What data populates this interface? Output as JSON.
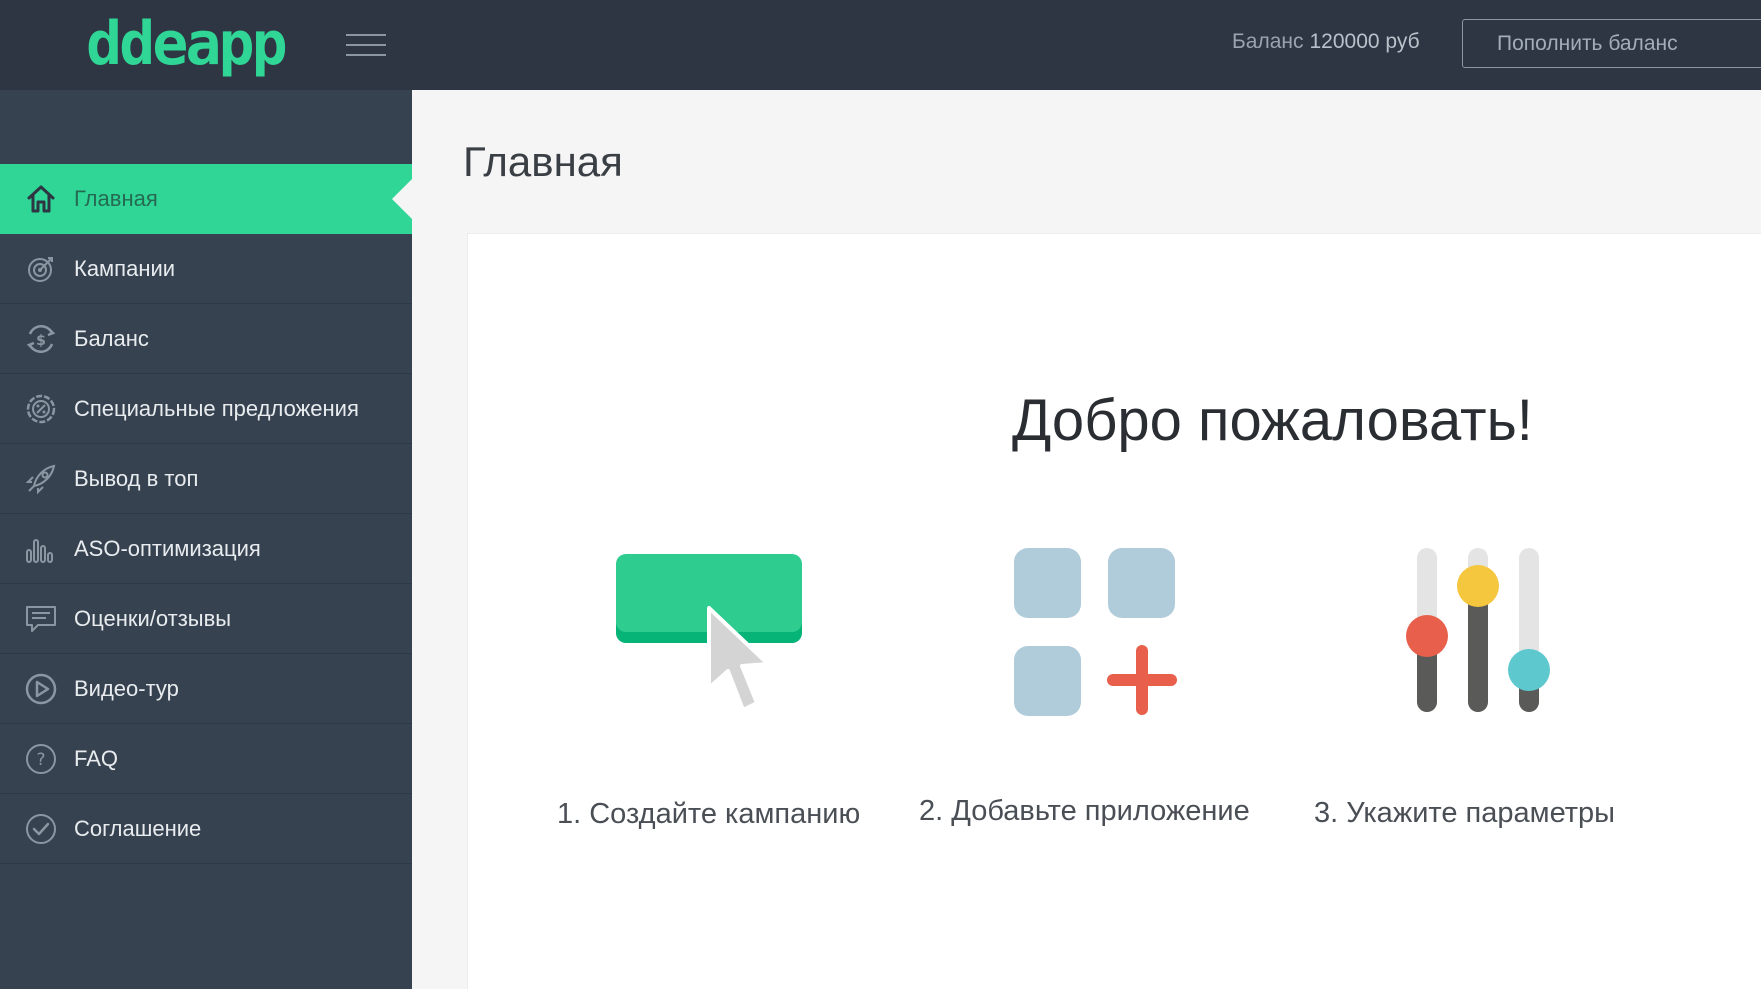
{
  "header": {
    "logo_text": "ddeapp",
    "balance_label": "Баланс",
    "balance_amount": "120000 руб",
    "topup_label": "Пополнить баланс",
    "hamburger_icon": "menu-icon"
  },
  "sidebar": {
    "items": [
      {
        "label": "Главная",
        "icon": "home-icon",
        "active": true
      },
      {
        "label": "Кампании",
        "icon": "target-icon"
      },
      {
        "label": "Баланс",
        "icon": "money-refresh-icon"
      },
      {
        "label": "Специальные предложения",
        "icon": "percent-badge-icon"
      },
      {
        "label": "Вывод в топ",
        "icon": "rocket-icon"
      },
      {
        "label": "ASO-оптимизация",
        "icon": "bar-chart-icon"
      },
      {
        "label": "Оценки/отзывы",
        "icon": "comment-icon"
      },
      {
        "label": "Видео-тур",
        "icon": "play-icon"
      },
      {
        "label": "FAQ",
        "icon": "question-icon"
      },
      {
        "label": "Соглашение",
        "icon": "check-circle-icon"
      }
    ]
  },
  "main": {
    "page_title": "Главная",
    "welcome": "Добро пожаловать!",
    "steps": [
      {
        "label": "1. Создайте кампанию",
        "icon": "button-click-icon"
      },
      {
        "label": "2. Добавьте приложение",
        "icon": "app-grid-add-icon"
      },
      {
        "label": "3. Укажите параметры",
        "icon": "sliders-icon"
      }
    ]
  },
  "colors": {
    "accent": "#2fd695",
    "topbar": "#2d3642",
    "sidebar": "#374250",
    "red": "#e8604c",
    "yellow": "#f4c73e",
    "teal": "#5ec8cf",
    "tile": "#b0cbd9"
  }
}
